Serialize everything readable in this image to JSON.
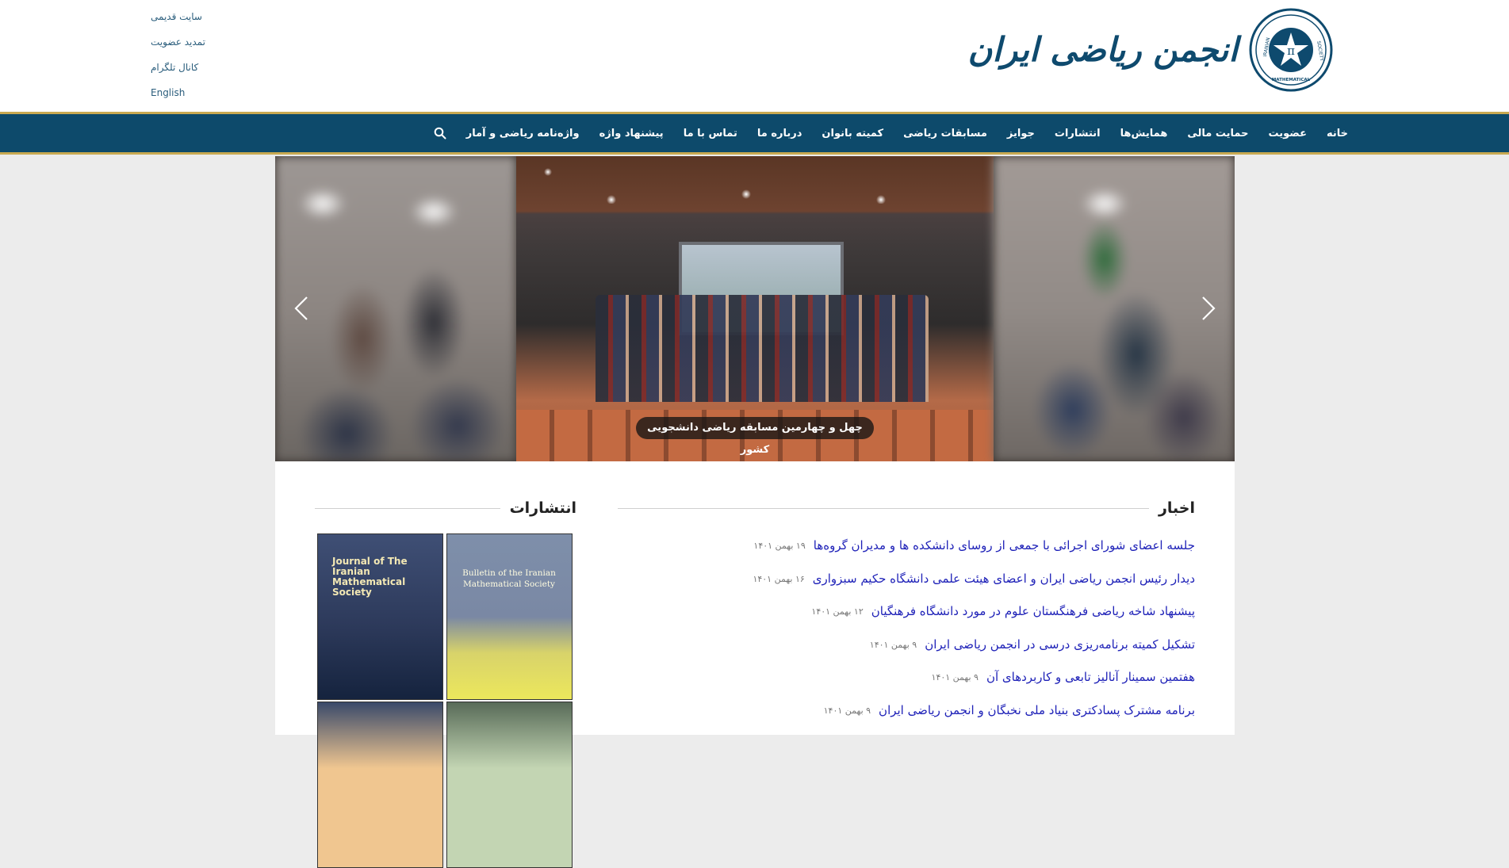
{
  "top_links": [
    "سایت قدیمی",
    "تمدید عضویت",
    "کانال تلگرام",
    "English"
  ],
  "logo": {
    "title": "انجمن ریاضی ایران",
    "emblem_text": [
      "IRANIAN",
      "SOCIETY",
      "MATHEMATICAL",
      "π"
    ]
  },
  "nav": {
    "items": [
      "خانه",
      "عضویت",
      "حمایت مالی",
      "همایش‌ها",
      "انتشارات",
      "جوایز",
      "مسابقات ریاضی",
      "کمیته بانوان",
      "درباره ما",
      "تماس با ما",
      "پیشنهاد واژه",
      "واژه‌نامه ریاضی و آمار"
    ],
    "search_icon": "search-icon"
  },
  "slider": {
    "caption": "چهل و چهارمین مسابقه ریاضی دانشجویی کشور",
    "prev_icon": "chevron-left-icon",
    "next_icon": "chevron-right-icon"
  },
  "news": {
    "title": "اخبار",
    "items": [
      {
        "title": "جلسه اعضای شورای اجرائی با جمعی از روسای دانشکده ها و مدیران گروه‌ها",
        "date": "۱۹ بهمن ۱۴۰۱"
      },
      {
        "title": "دیدار رئیس انجمن ریاضی ایران و اعضای هیئت علمی دانشگاه حکیم سبزواری",
        "date": "۱۶ بهمن ۱۴۰۱"
      },
      {
        "title": "پیشنهاد شاخه ریاضی فرهنگستان علوم در مورد دانشگاه فرهنگیان",
        "date": "۱۲ بهمن ۱۴۰۱"
      },
      {
        "title": "تشکیل کمیته برنامه‌ریزی درسی در انجمن ریاضی ایران",
        "date": "۹ بهمن ۱۴۰۱"
      },
      {
        "title": "هفتمین سمینار آنالیز تابعی و کاربردهای آن",
        "date": "۹ بهمن ۱۴۰۱"
      },
      {
        "title": "برنامه مشترک پسادکتری بنیاد ملی نخبگان و انجمن ریاضی ایران",
        "date": "۹ بهمن ۱۴۰۱"
      }
    ]
  },
  "publications": {
    "title": "انتشارات",
    "books": [
      {
        "title": "Bulletin of the Iranian Mathematical Society"
      },
      {
        "title": "Journal of The Iranian Mathematical Society"
      }
    ]
  },
  "colors": {
    "nav_bg": "#0d4a6b",
    "gold": "#c8a951",
    "news_link": "#1f22b8"
  }
}
